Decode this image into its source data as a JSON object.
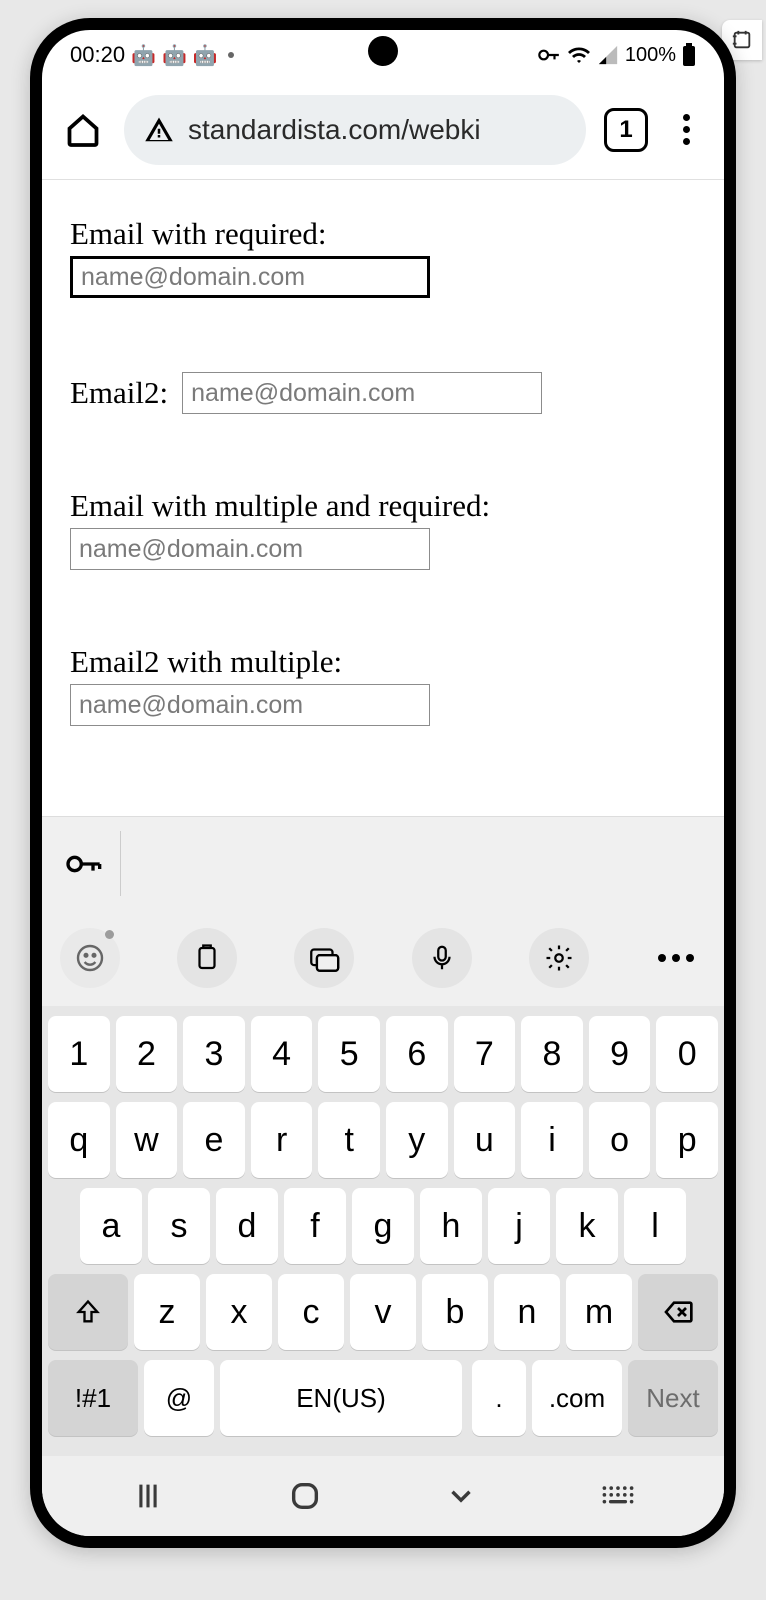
{
  "status": {
    "time": "00:20",
    "battery": "100%"
  },
  "browser": {
    "url": "standardista.com/webki",
    "tab_count": "1"
  },
  "form": {
    "f1_label": "Email with required:",
    "f1_placeholder": "name@domain.com",
    "f2_label": "Email2:",
    "f2_placeholder": "name@domain.com",
    "f3_label": "Email with multiple and required:",
    "f3_placeholder": "name@domain.com",
    "f4_label": "Email2 with multiple:",
    "f4_placeholder": "name@domain.com"
  },
  "keyboard": {
    "row1": [
      "1",
      "2",
      "3",
      "4",
      "5",
      "6",
      "7",
      "8",
      "9",
      "0"
    ],
    "row2": [
      "q",
      "w",
      "e",
      "r",
      "t",
      "y",
      "u",
      "i",
      "o",
      "p"
    ],
    "row3": [
      "a",
      "s",
      "d",
      "f",
      "g",
      "h",
      "j",
      "k",
      "l"
    ],
    "row4": [
      "z",
      "x",
      "c",
      "v",
      "b",
      "n",
      "m"
    ],
    "sym": "!#1",
    "at": "@",
    "space": "EN(US)",
    "dot": ".",
    "com": ".com",
    "next": "Next"
  }
}
